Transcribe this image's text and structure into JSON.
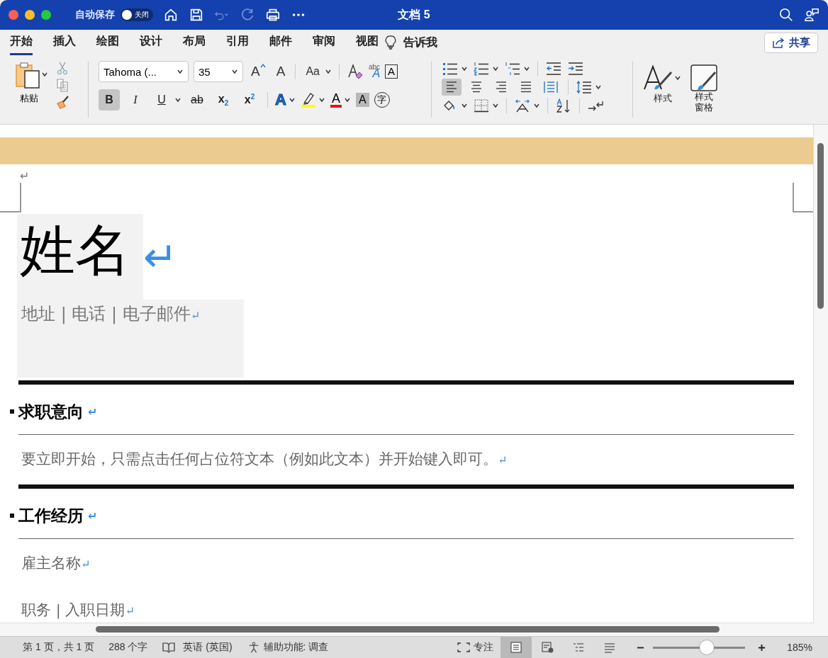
{
  "window": {
    "title": "文档 5",
    "autosave_label": "自动保存",
    "autosave": {
      "on": false,
      "label": "关闭"
    }
  },
  "tabs": [
    {
      "label": "开始",
      "selected": true
    },
    {
      "label": "插入",
      "selected": false
    },
    {
      "label": "绘图",
      "selected": false
    },
    {
      "label": "设计",
      "selected": false
    },
    {
      "label": "布局",
      "selected": false
    },
    {
      "label": "引用",
      "selected": false
    },
    {
      "label": "邮件",
      "selected": false
    },
    {
      "label": "审阅",
      "selected": false
    },
    {
      "label": "视图",
      "selected": false
    }
  ],
  "tell_me": "告诉我",
  "share": "共享",
  "ribbon": {
    "paste_label": "粘贴",
    "font": "Tahoma (...",
    "size": "35",
    "size_buttons": [
      {
        "kind": "grow",
        "glyph": "A"
      },
      {
        "kind": "shrink",
        "glyph": "A"
      },
      {
        "kind": "case",
        "glyph": "Aa"
      }
    ],
    "format_buttons": [
      {
        "kind": "bold",
        "glyph": "B",
        "selected": true
      },
      {
        "kind": "italic",
        "glyph": "I",
        "selected": false
      },
      {
        "kind": "underline",
        "glyph": "U",
        "selected": false
      },
      {
        "kind": "strike",
        "glyph": "ab",
        "selected": false
      },
      {
        "kind": "sub",
        "glyph": "x$_{2}$",
        "selected": false
      },
      {
        "kind": "sup",
        "glyph": "x$^{2}$",
        "selected": false
      }
    ],
    "color_buttons": [
      {
        "kind": "effects",
        "glyph": "A"
      },
      {
        "kind": "highlight",
        "color": "#ffff00"
      },
      {
        "kind": "fontcolor",
        "glyph": "A",
        "color": "#e81123"
      },
      {
        "kind": "shade",
        "glyph": "A"
      },
      {
        "kind": "phonetic",
        "glyph": "字"
      }
    ],
    "extra_glyphs": {
      "abc": "abc",
      "abc_a": "A",
      "boxed": "A"
    },
    "align": [
      {
        "kind": "left",
        "selected": true
      },
      {
        "kind": "center",
        "selected": false
      },
      {
        "kind": "right",
        "selected": false
      },
      {
        "kind": "justify",
        "selected": false
      },
      {
        "kind": "distributed",
        "selected": false
      }
    ],
    "styles_label": "样式",
    "styles_pane_label": "样式窗格"
  },
  "document": {
    "mark": "↵",
    "name": "姓名",
    "contact": "地址 | 电话 | 电子邮件",
    "sections": [
      {
        "heading": "求职意向",
        "paragraphs": [
          "要立即开始，只需点击任何占位符文本（例如此文本）并开始键入即可。"
        ]
      },
      {
        "heading": "工作经历",
        "paragraphs": [
          "雇主名称",
          "职务 | 入职日期"
        ]
      }
    ]
  },
  "status_bar": {
    "page": "第 1 页，共 1 页",
    "words": "288 个字",
    "language": "英语 (英国)",
    "accessibility": "辅助功能: 调查",
    "focus": "专注",
    "views": [
      {
        "kind": "print",
        "selected": true
      },
      {
        "kind": "web",
        "selected": false
      },
      {
        "kind": "outline",
        "selected": false
      },
      {
        "kind": "draft",
        "selected": false
      }
    ],
    "zoom": {
      "level": 0.58,
      "label": "185%"
    }
  }
}
